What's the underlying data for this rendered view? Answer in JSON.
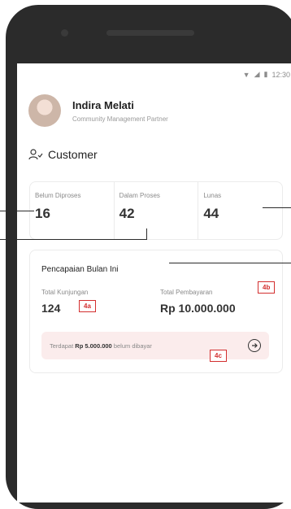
{
  "status_bar": {
    "time": "12:30"
  },
  "profile": {
    "name": "Indira Melati",
    "role": "Community Management Partner"
  },
  "section": {
    "title": "Customer"
  },
  "stats": [
    {
      "label": "Belum Diproses",
      "value": "16"
    },
    {
      "label": "Dalam Proses",
      "value": "42"
    },
    {
      "label": "Lunas",
      "value": "44"
    }
  ],
  "achievement": {
    "title": "Pencapaian Bulan Ini",
    "visits_label": "Total Kunjungan",
    "visits_value": "124",
    "payment_label": "Total Pembayaran",
    "payment_value": "Rp 10.000.000",
    "notice_prefix": "Terdapat ",
    "notice_amount": "Rp 5.000.000",
    "notice_suffix": " belum dibayar"
  },
  "annotations": {
    "a": "4a",
    "b": "4b",
    "c": "4c"
  }
}
